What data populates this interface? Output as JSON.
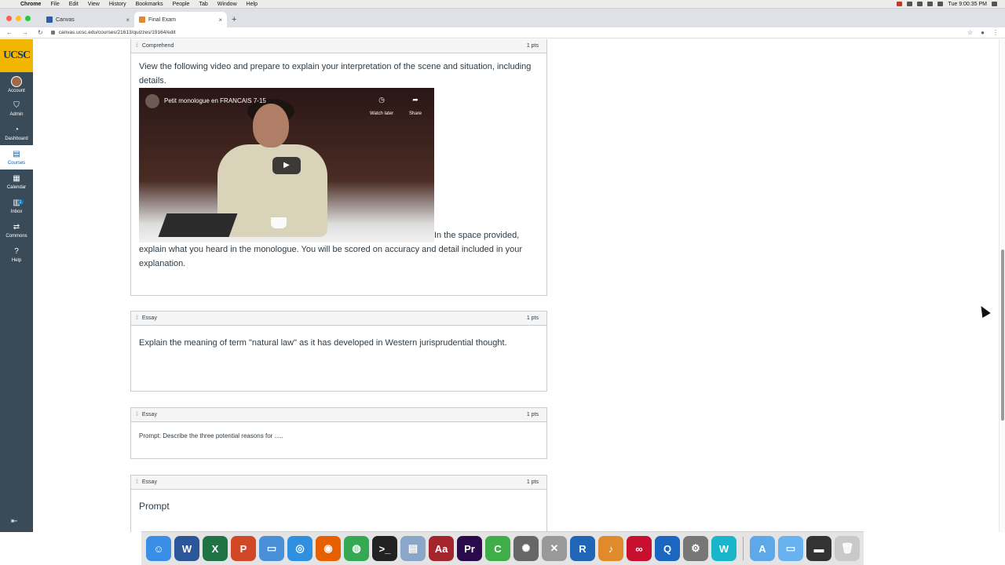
{
  "menubar": {
    "apple": "",
    "app": "Chrome",
    "items": [
      "File",
      "Edit",
      "View",
      "History",
      "Bookmarks",
      "People",
      "Tab",
      "Window",
      "Help"
    ],
    "clock": "Tue 9:00:35 PM"
  },
  "browser": {
    "tabs": [
      {
        "title": "Canvas",
        "active": false
      },
      {
        "title": "Final Exam",
        "active": true
      }
    ],
    "new_tab": "+",
    "url": "canvas.ucsc.edu/courses/21613/quizzes/19164/edit"
  },
  "gnav": {
    "logo": "UCSC",
    "items": [
      {
        "label": "Account",
        "icon": "avatar-icon"
      },
      {
        "label": "Admin",
        "icon": "shield-icon"
      },
      {
        "label": "Dashboard",
        "icon": "dashboard-icon"
      },
      {
        "label": "Courses",
        "icon": "book-icon"
      },
      {
        "label": "Calendar",
        "icon": "calendar-icon"
      },
      {
        "label": "Inbox",
        "icon": "inbox-icon",
        "badge": "1"
      },
      {
        "label": "Commons",
        "icon": "commons-icon"
      },
      {
        "label": "Help",
        "icon": "help-icon"
      }
    ],
    "collapse": "⇤"
  },
  "questions": [
    {
      "type": "Comprehend",
      "points": "1 pts",
      "text_before": "View the following video and prepare to explain your interpretation of the scene and situation, including details.",
      "video": {
        "title": "Petit monologue en FRANCAIS 7-15",
        "watch_later": "Watch later",
        "share": "Share"
      },
      "text_after": "In the space provided, explain what you heard in the monologue. You will be scored on accuracy and detail included in your explanation."
    },
    {
      "type": "Essay",
      "points": "1 pts",
      "text": "Explain the meaning of term \"natural law\" as it has developed in Western jurisprudential thought."
    },
    {
      "type": "Essay",
      "points": "1 pts",
      "text": "Prompt: Describe the three potential reasons for ....."
    },
    {
      "type": "Essay",
      "points": "1 pts",
      "text": "Prompt"
    }
  ],
  "dock": [
    {
      "name": "Finder",
      "color": "#3a8ee6",
      "glyph": "☺"
    },
    {
      "name": "Word",
      "color": "#2b579a",
      "glyph": "W"
    },
    {
      "name": "Excel",
      "color": "#217346",
      "glyph": "X"
    },
    {
      "name": "PowerPoint",
      "color": "#d24726",
      "glyph": "P"
    },
    {
      "name": "Keynote",
      "color": "#4a90d9",
      "glyph": "▭"
    },
    {
      "name": "Safari",
      "color": "#2f8fe0",
      "glyph": "◎"
    },
    {
      "name": "Firefox",
      "color": "#e66000",
      "glyph": "◉"
    },
    {
      "name": "Chrome",
      "color": "#34a853",
      "glyph": "◍"
    },
    {
      "name": "Terminal",
      "color": "#222222",
      "glyph": ">_"
    },
    {
      "name": "Preview",
      "color": "#8aa6c8",
      "glyph": "▤"
    },
    {
      "name": "Acrobat",
      "color": "#a4262c",
      "glyph": "Aa"
    },
    {
      "name": "Premiere",
      "color": "#2a0a4a",
      "glyph": "Pr"
    },
    {
      "name": "Camtasia",
      "color": "#3fae49",
      "glyph": "C"
    },
    {
      "name": "Compressor",
      "color": "#666666",
      "glyph": "✺"
    },
    {
      "name": "Grapher",
      "color": "#999999",
      "glyph": "✕"
    },
    {
      "name": "R",
      "color": "#2165b6",
      "glyph": "R"
    },
    {
      "name": "GarageBand",
      "color": "#e08a2b",
      "glyph": "♪"
    },
    {
      "name": "Creative Cloud",
      "color": "#c8102e",
      "glyph": "∞"
    },
    {
      "name": "QuickTime",
      "color": "#1a66c1",
      "glyph": "Q"
    },
    {
      "name": "System Preferences",
      "color": "#777777",
      "glyph": "⚙"
    },
    {
      "name": "Webex",
      "color": "#19b5c9",
      "glyph": "W"
    },
    {
      "name": "Applications",
      "color": "#5fa8e8",
      "glyph": "A"
    },
    {
      "name": "Folder",
      "color": "#68b3ef",
      "glyph": "▭"
    },
    {
      "name": "Screen",
      "color": "#333333",
      "glyph": "▬"
    },
    {
      "name": "Trash",
      "color": "#c9c9c9",
      "glyph": "🗑"
    }
  ]
}
